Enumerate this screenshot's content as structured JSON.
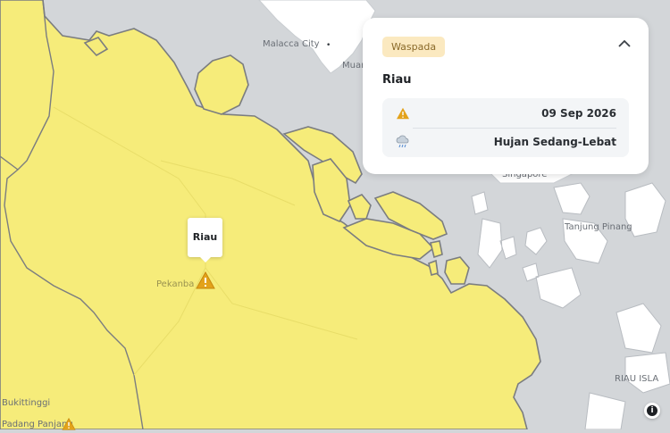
{
  "map": {
    "labels": {
      "malacca": "Malacca City",
      "muar": "Muar",
      "singapore": "Singapore",
      "tanjung_pinang": "Tanjung Pinang",
      "pekanbaru": "Pekanba",
      "bukittinggi": "Bukittinggi",
      "padang_panjang": "Padang Panjang",
      "riau_islands": "RIAU ISLA"
    },
    "colors": {
      "warning_area": "#f6ec7a",
      "sea": "#d3d6d9",
      "border": "#7b7d80",
      "neighbor_land": "#ffffff"
    }
  },
  "tooltip": {
    "label": "Riau"
  },
  "marker": {
    "icon": "warning-triangle-icon",
    "color": "#e3a21a"
  },
  "info_card": {
    "level_badge": "Waspada",
    "region": "Riau",
    "date": "09 Sep 2026",
    "weather": "Hujan Sedang-Lebat",
    "date_icon": "warning-triangle-icon",
    "weather_icon": "cloud-rain-icon",
    "toggle_icon": "chevron-up-icon",
    "badge_color": "#fbe9c0"
  },
  "info_button": {
    "icon": "info-icon",
    "text": "i"
  }
}
